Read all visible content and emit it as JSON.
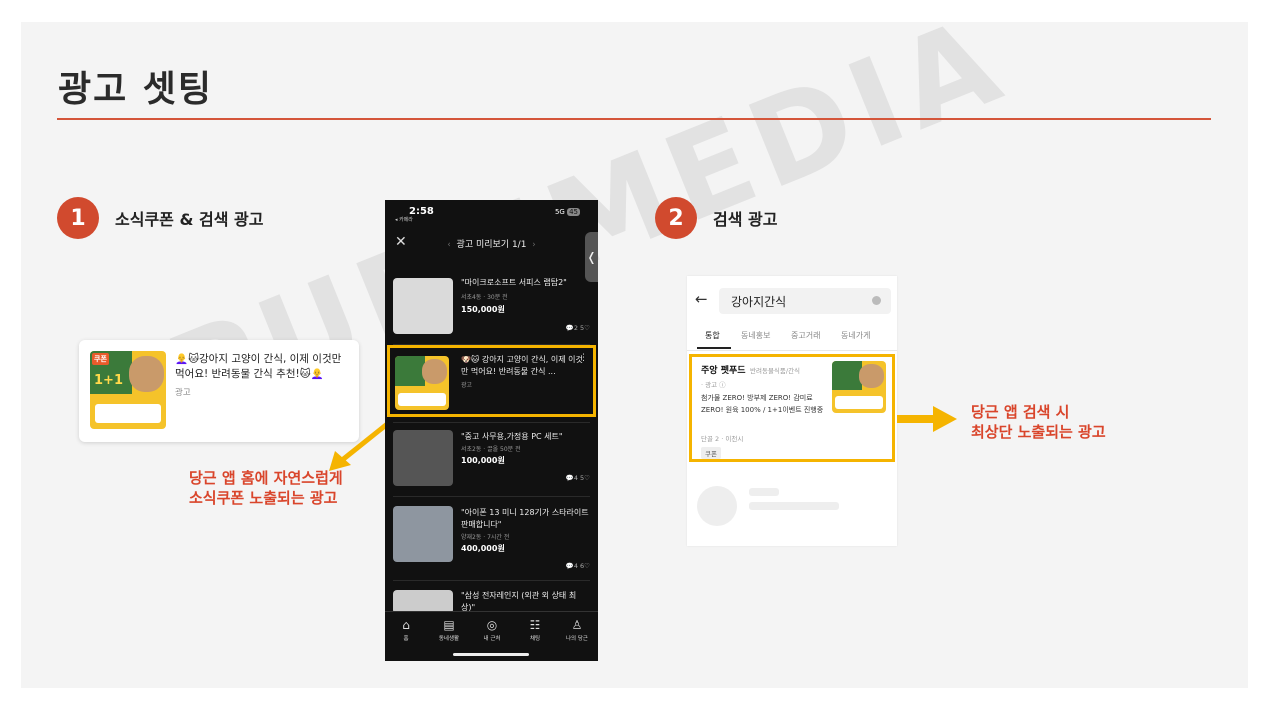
{
  "slide": {
    "title": "광고 셋팅",
    "watermark": "PURUMEDIA"
  },
  "steps": [
    {
      "number": "1",
      "label": "소식쿠폰 & 검색 광고"
    },
    {
      "number": "2",
      "label": "검색 광고"
    }
  ],
  "ad_card": {
    "text": "👩‍🦲🐱강아지 고양이 간식, 이제 이것만 먹어요! 반려동물 간식 추천!🐱👩‍🦲",
    "sub": "광고",
    "thumb_badge": "쿠폰",
    "thumb_text": "1+1"
  },
  "note_home": {
    "line1": "당근 앱 홈에 자연스럽게",
    "line2": "소식쿠폰 노출되는 광고"
  },
  "note_search": {
    "line1": "당근 앱 검색 시",
    "line2": "최상단 노출되는 광고"
  },
  "phone": {
    "time": "2:58",
    "back_label": "◂ 카메라",
    "network": "5G",
    "battery": "45",
    "header": "광고 미리보기 1/1",
    "items": [
      {
        "title": "\"마이크로소프트 서피스 랩탑2\"",
        "meta": "서초4동 · 30분 전",
        "price": "150,000원",
        "counts": "2  5"
      },
      {
        "title": "🐶🐱 강아지 고양이 간식, 이제 이것만 먹어요! 반려동물 간식 ...",
        "meta": "광고",
        "price": "",
        "counts": ""
      },
      {
        "title": "\"중고 사무용,가정용 PC 세트\"",
        "meta": "서초2동 · 끌올 50분 전",
        "price": "100,000원",
        "counts": "4  5"
      },
      {
        "title": "\"아이폰 13 미니 128기가 스타라이트 판매합니다\"",
        "meta": "양재2동 · 7시간 전",
        "price": "400,000원",
        "counts": "4  6"
      },
      {
        "title": "\"삼성 전자레인지 (외관 외 상태 최상)\"",
        "meta": "",
        "price": "",
        "counts": ""
      }
    ],
    "nav": [
      {
        "icon": "⌂",
        "label": "홈"
      },
      {
        "icon": "▤",
        "label": "동네생활"
      },
      {
        "icon": "◎",
        "label": "내 근처"
      },
      {
        "icon": "☷",
        "label": "채팅"
      },
      {
        "icon": "♙",
        "label": "나의 당근"
      }
    ]
  },
  "search": {
    "query": "강아지간식",
    "tabs": [
      "통합",
      "동네홍보",
      "중고거래",
      "동네가게"
    ],
    "result": {
      "name": "주앙 펫푸드",
      "category": "반려동물식품/간식",
      "ad": "· 광고 ⓘ",
      "desc": "첨가물 ZERO! 방부제 ZERO! 감미료 ZERO! 원육 100% / 1+1이벤트 진행중",
      "location": "단골 2 · 이천시",
      "badge": "쿠폰"
    }
  },
  "colors": {
    "accent": "#d14a2e",
    "highlight": "#f5b400",
    "note": "#d9452b"
  }
}
